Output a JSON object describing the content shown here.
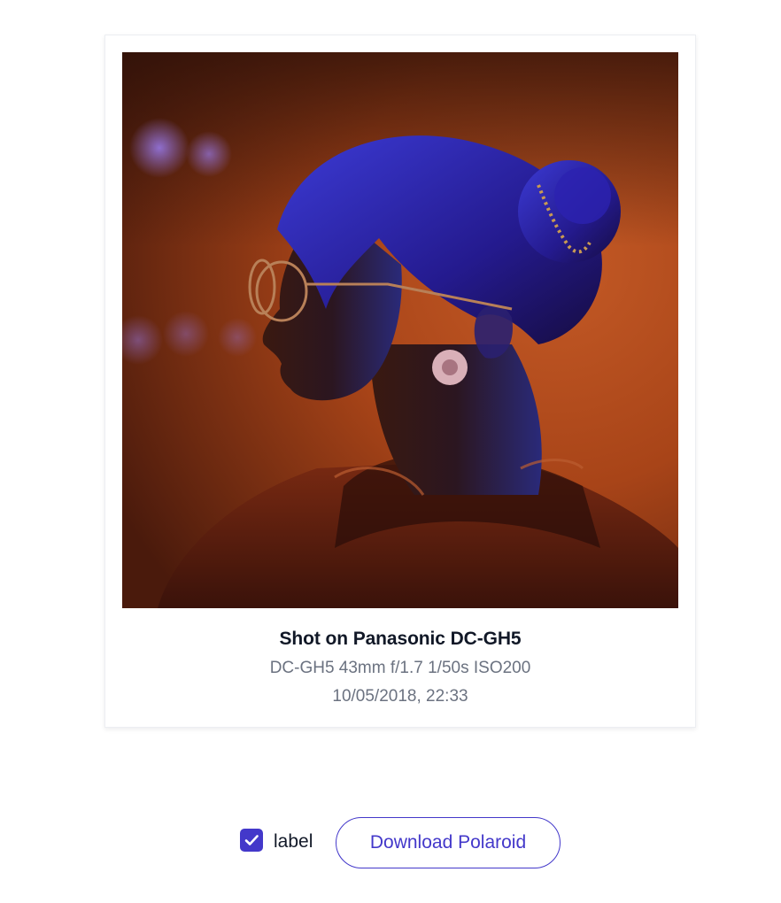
{
  "polaroid": {
    "title": "Shot on Panasonic DC-GH5",
    "exif": "DC-GH5 43mm f/1.7 1/50s ISO200",
    "datetime": "10/05/2018, 22:33"
  },
  "controls": {
    "checkbox_label": "label",
    "checkbox_checked": true,
    "download_label": "Download Polaroid"
  },
  "colors": {
    "accent": "#4338ca",
    "title_text": "#111827",
    "meta_text": "#6b7280"
  }
}
